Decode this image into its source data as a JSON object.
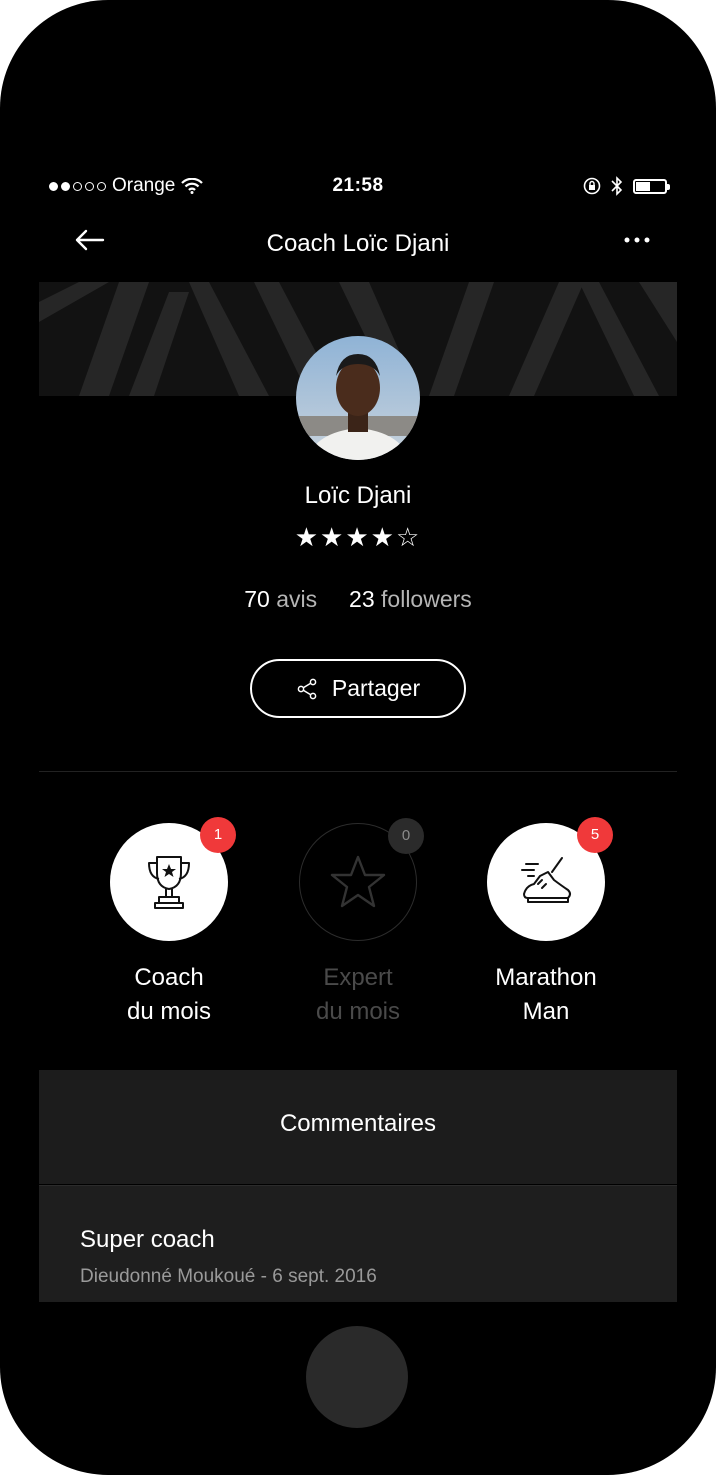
{
  "status_bar": {
    "carrier": "Orange",
    "time": "21:58"
  },
  "nav": {
    "title": "Coach Loïc Djani"
  },
  "profile": {
    "name": "Loïc Djani",
    "rating_stars": "★★★★☆",
    "rating_value": 4,
    "rating_max": 5,
    "reviews_count": "70",
    "reviews_label": "avis",
    "followers_count": "23",
    "followers_label": "followers",
    "share_label": "Partager"
  },
  "badges": [
    {
      "line1": "Coach",
      "line2": "du mois",
      "count": "1",
      "icon": "trophy-icon",
      "active": true
    },
    {
      "line1": "Expert",
      "line2": "du mois",
      "count": "0",
      "icon": "star-icon",
      "active": false
    },
    {
      "line1": "Marathon",
      "line2": "Man",
      "count": "5",
      "icon": "running-shoe-icon",
      "active": true
    }
  ],
  "comments": {
    "title": "Commentaires",
    "items": [
      {
        "title": "Super coach",
        "meta": "Dieudonné Moukoué - 6 sept. 2016"
      }
    ]
  },
  "colors": {
    "background": "#000000",
    "badge_count": "#f0393a",
    "panel": "#1c1c1c"
  }
}
